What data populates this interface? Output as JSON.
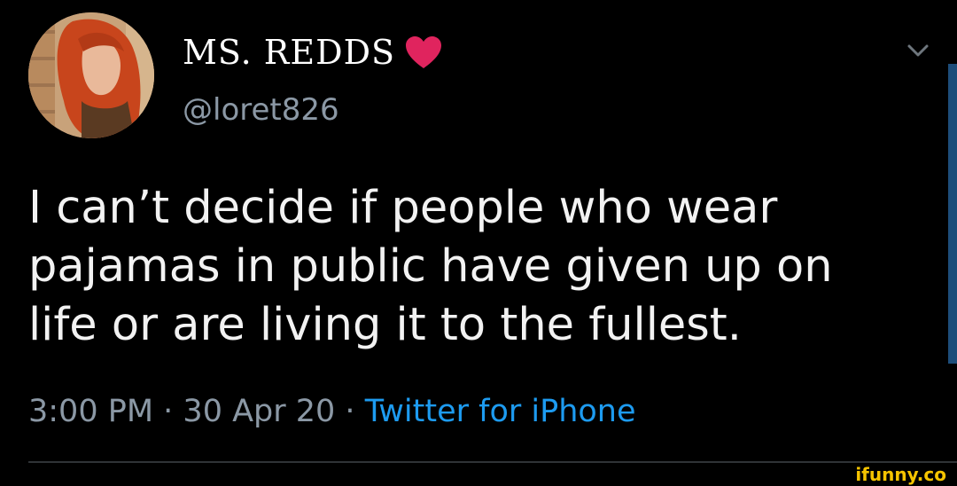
{
  "tweet": {
    "author": {
      "display_name": "MS. REDDS",
      "handle": "@loret826",
      "heart_color": "#e0245e"
    },
    "text_lines": [
      "I can’t decide if people who wear",
      "pajamas in public have given up on",
      "life or are living it to the fullest."
    ],
    "meta": {
      "time": "3:00 PM",
      "separator": " · ",
      "date": "30 Apr 20",
      "source": "Twitter for iPhone"
    },
    "menu_icon": "chevron-down-icon"
  },
  "watermark": {
    "text": "ifunny.co",
    "color": "#f5c400"
  },
  "colors": {
    "background": "#000000",
    "text": "#f2f2f2",
    "secondary": "#8b98a5",
    "link": "#1d9bf0"
  }
}
